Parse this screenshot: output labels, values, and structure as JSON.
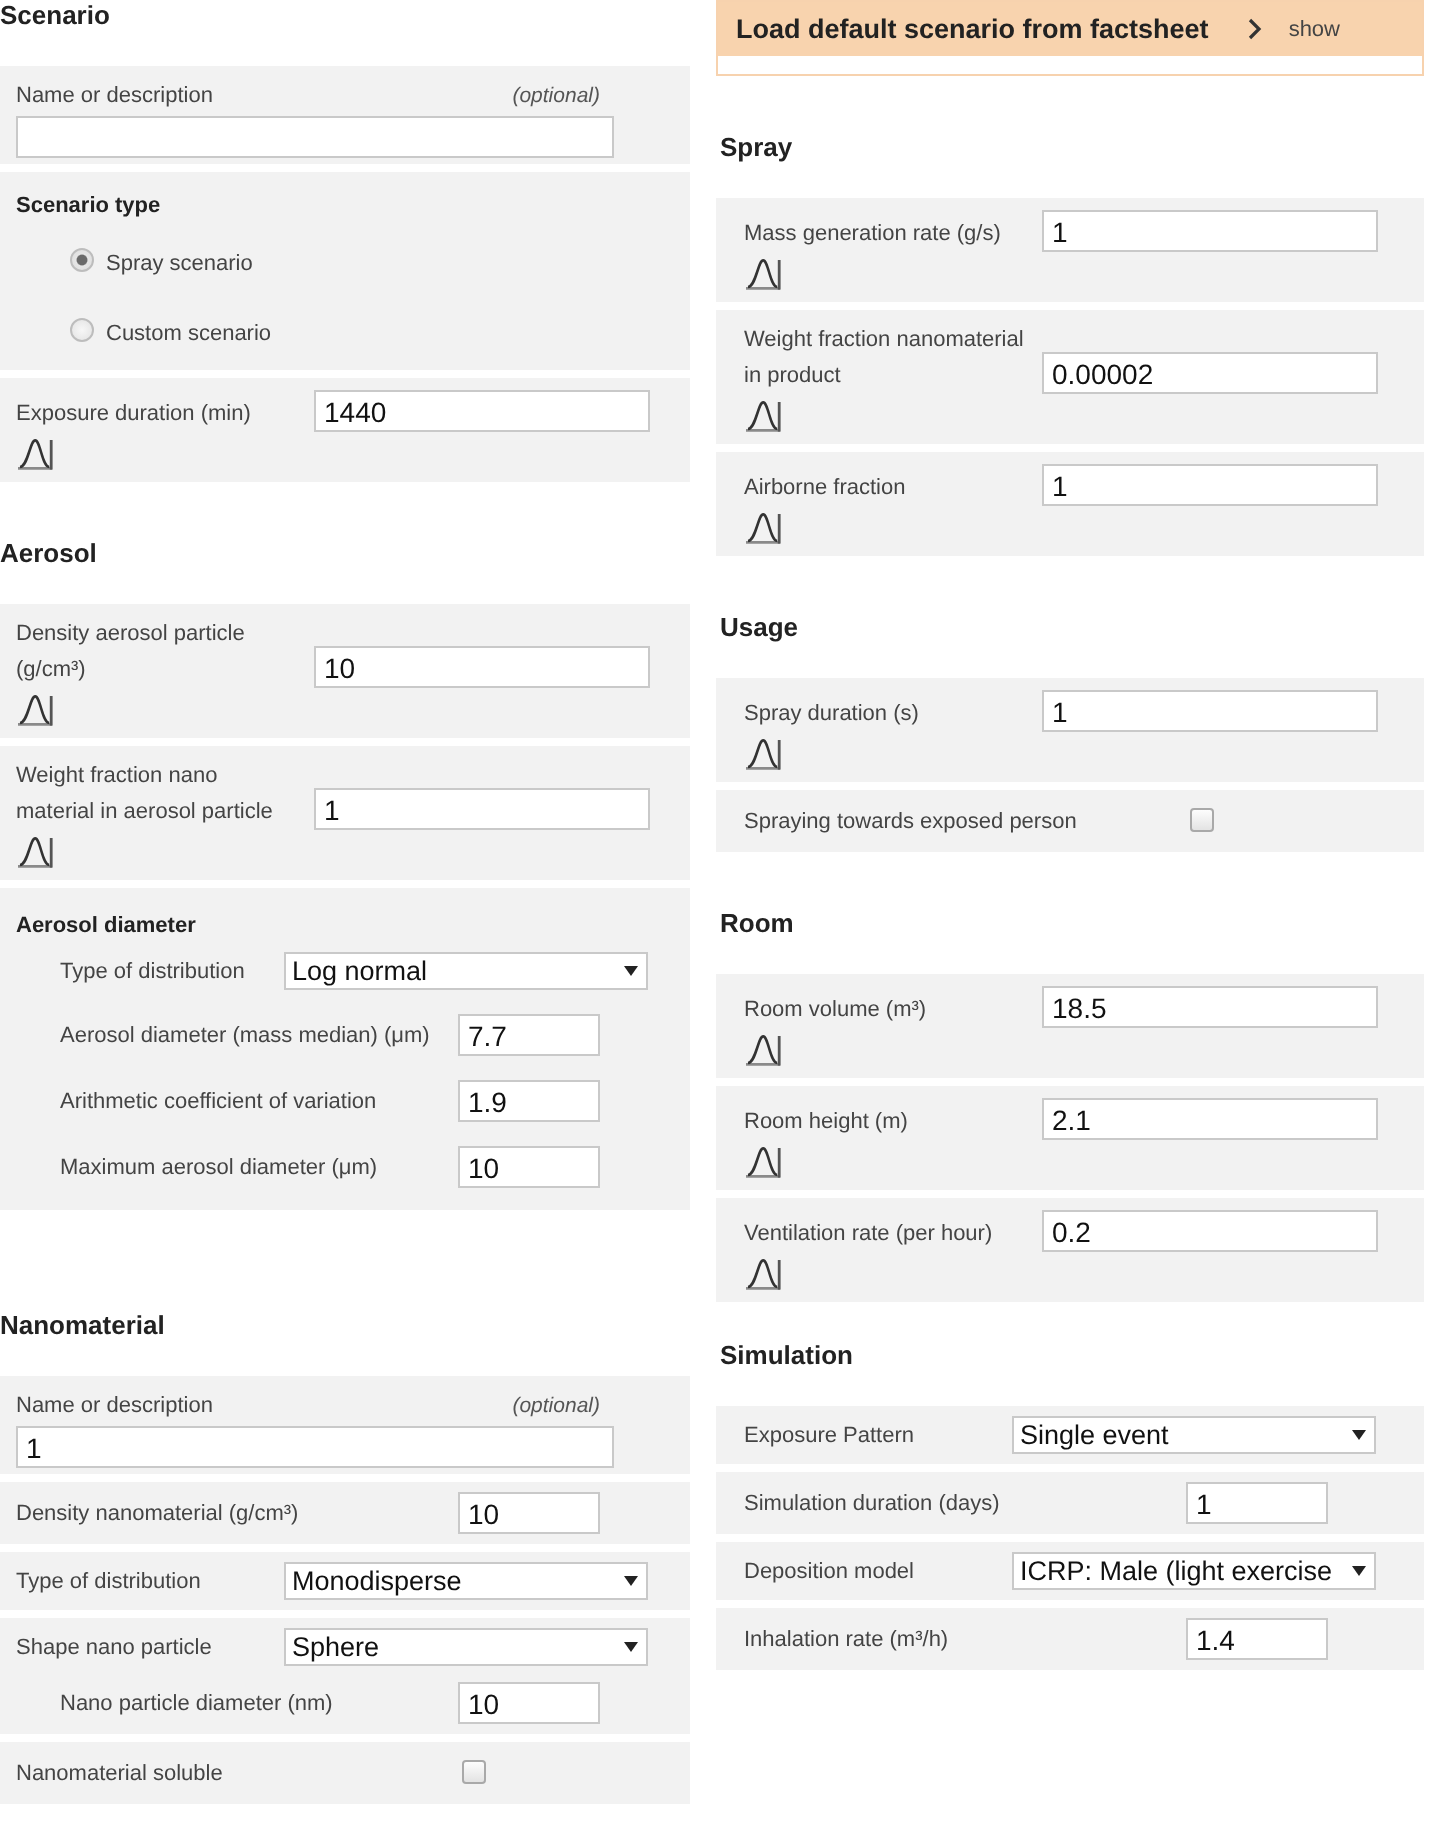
{
  "left_column": {
    "sections": [
      {
        "title": "Scenario",
        "panels": [
          {
            "kind": "text_field",
            "label": "Name or description",
            "note": "(optional)"
          },
          {
            "kind": "radio_group",
            "title": "Scenario type",
            "options": [
              {
                "label": "Spray scenario",
                "selected": true
              },
              {
                "label": "Custom scenario",
                "selected": false
              }
            ]
          },
          {
            "kind": "input",
            "label": "Exposure duration (min)",
            "value": "1440"
          }
        ]
      },
      {
        "title": "Aerosol",
        "panels": [
          {
            "kind": "input",
            "label": "Density aerosol particle (g/cm³)",
            "value": "10"
          },
          {
            "kind": "input",
            "label": "Weight fraction nano material in aerosol particle",
            "value": "1"
          },
          {
            "kind": "group",
            "title": "Aerosol diameter",
            "children": [
              {
                "kind": "select",
                "label": "Type of distribution",
                "value": "Log normal"
              },
              {
                "kind": "short_input",
                "label": "Aerosol diameter (mass median) (μm)",
                "value": "7.7"
              },
              {
                "kind": "short_input",
                "label": "Arithmetic coefficient of variation",
                "value": "1.9"
              },
              {
                "kind": "short_input",
                "label": "Maximum aerosol diameter (μm)",
                "value": "10"
              }
            ]
          }
        ]
      },
      {
        "title": "Nanomaterial",
        "panels": [
          {
            "kind": "text_field",
            "label": "Name or description",
            "note": "(optional)",
            "value": "1"
          },
          {
            "kind": "short_input",
            "label": "Density nanomaterial (g/cm³)",
            "value": "10"
          },
          {
            "kind": "select",
            "label": "Type of distribution",
            "value": "Monodisperse"
          },
          {
            "kind": "select",
            "label": "Shape nano particle",
            "value": "Sphere",
            "children": [
              {
                "kind": "short_input",
                "label": "Nano particle diameter (nm)",
                "value": "10"
              }
            ]
          },
          {
            "kind": "checkbox",
            "label": "Nanomaterial soluble",
            "checked": false
          }
        ]
      }
    ]
  },
  "right_column": {
    "banner": {
      "title": "Load default scenario from factsheet",
      "toggle": "show"
    },
    "sections": [
      {
        "title": "Spray",
        "panels": [
          {
            "kind": "input",
            "label": "Mass generation rate (g/s)",
            "value": "1"
          },
          {
            "kind": "input",
            "label": "Weight fraction nanomaterial in product",
            "value": "0.00002"
          },
          {
            "kind": "input",
            "label": "Airborne fraction",
            "value": "1"
          }
        ]
      },
      {
        "title": "Usage",
        "panels": [
          {
            "kind": "input",
            "label": "Spray duration (s)",
            "value": "1"
          },
          {
            "kind": "checkbox",
            "label": "Spraying towards exposed person",
            "checked": false
          }
        ]
      },
      {
        "title": "Room",
        "panels": [
          {
            "kind": "input",
            "label": "Room volume (m³)",
            "value": "18.5"
          },
          {
            "kind": "input",
            "label": "Room height (m)",
            "value": "2.1"
          },
          {
            "kind": "input",
            "label": "Ventilation rate (per hour)",
            "value": "0.2"
          }
        ]
      },
      {
        "title": "Simulation",
        "panels": [
          {
            "kind": "select",
            "label": "Exposure Pattern",
            "value": "Single event"
          },
          {
            "kind": "short_input",
            "label": "Simulation duration (days)",
            "value": "1"
          },
          {
            "kind": "select",
            "label": "Deposition model",
            "value": "ICRP: Male (light exercise"
          },
          {
            "kind": "short_input",
            "label": "Inhalation rate (m³/h)",
            "value": "1.4"
          }
        ]
      }
    ]
  }
}
